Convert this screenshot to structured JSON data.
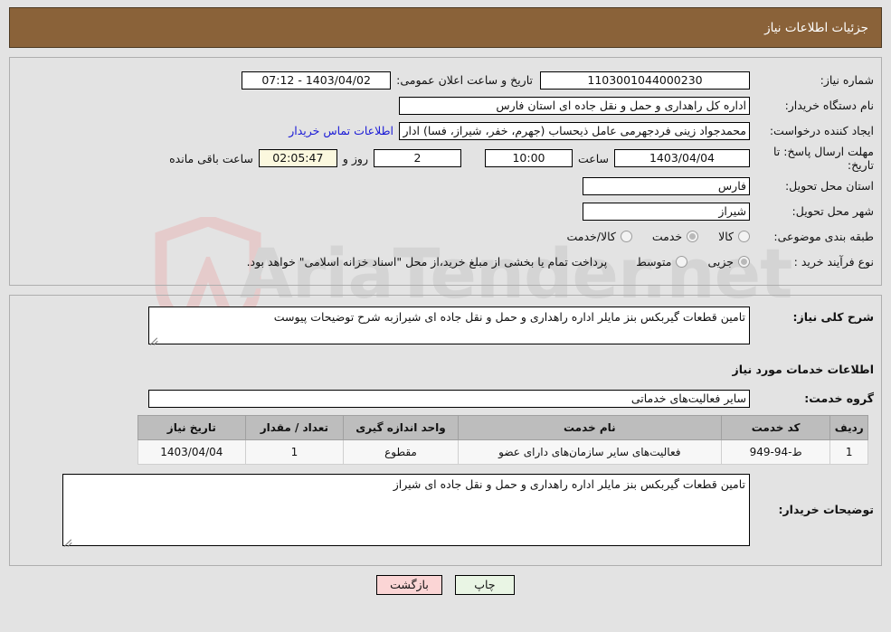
{
  "header": {
    "title": "جزئیات اطلاعات نیاز"
  },
  "form": {
    "need_number_label": "شماره نیاز:",
    "need_number_value": "1103001044000230",
    "public_announce_label": "تاریخ و ساعت اعلان عمومی:",
    "public_announce_value": "1403/04/02 - 07:12",
    "buyer_org_label": "نام دستگاه خریدار:",
    "buyer_org_value": "اداره کل راهداری و حمل و نقل جاده ای استان فارس",
    "requester_label": "ایجاد کننده درخواست:",
    "requester_value": "محمدجواد زینی فردجهرمی عامل ذیحساب (جهرم، خفر، شیراز، فسا) اداره کل ر",
    "contact_link": "اطلاعات تماس خریدار",
    "deadline_label": "مهلت ارسال پاسخ: تا تاریخ:",
    "deadline_date": "1403/04/04",
    "hour_label": "ساعت",
    "hour_value": "10:00",
    "days_value": "2",
    "days_label": "روز و",
    "timer_value": "02:05:47",
    "timer_label": "ساعت باقی مانده",
    "province_label": "استان محل تحویل:",
    "province_value": "فارس",
    "city_label": "شهر محل تحویل:",
    "city_value": "شیراز",
    "category_label": "طبقه بندی موضوعی:",
    "category_options": [
      {
        "label": "کالا",
        "selected": false
      },
      {
        "label": "خدمت",
        "selected": true
      },
      {
        "label": "کالا/خدمت",
        "selected": false
      }
    ],
    "process_label": "نوع فرآیند خرید :",
    "process_options": [
      {
        "label": "جزیی",
        "selected": true
      },
      {
        "label": "متوسط",
        "selected": false
      }
    ],
    "treasury_note": "پرداخت تمام یا بخشی از مبلغ خرید،از محل \"اسناد خزانه اسلامی\" خواهد بود."
  },
  "body": {
    "need_desc_label": "شرح کلی نیاز:",
    "need_desc_value": "تامین قطعات گیربکس بنز مایلر اداره راهداری و حمل و نقل جاده ای شیرازبه شرح توضیحات پیوست",
    "services_section_title": "اطلاعات خدمات مورد نیاز",
    "service_group_label": "گروه خدمت:",
    "service_group_value": "سایر فعالیت‌های خدماتی",
    "buyer_desc_label": "توضیحات خریدار:",
    "buyer_desc_value": "تامین قطعات گیربکس بنز مایلر اداره راهداری و حمل و نقل جاده ای شیراز"
  },
  "table": {
    "columns": [
      "ردیف",
      "کد خدمت",
      "نام خدمت",
      "واحد اندازه گیری",
      "تعداد / مقدار",
      "تاریخ نیاز"
    ],
    "rows": [
      {
        "radif": "1",
        "code": "ط-94-949",
        "name": "فعالیت‌های سایر سازمان‌های دارای عضو",
        "unit": "مقطوع",
        "qty": "1",
        "date": "1403/04/04"
      }
    ]
  },
  "footer": {
    "print_label": "چاپ",
    "back_label": "بازگشت"
  },
  "watermark": {
    "text_a": "AriaTender",
    "text_b": ".net"
  },
  "colors": {
    "header_bg": "#8a6239",
    "link": "#1a1ad6",
    "timer_bg": "#fbf8de",
    "back_btn": "#fbd5d5",
    "print_btn": "#e9f5e4",
    "table_header": "#bdbdbd"
  }
}
